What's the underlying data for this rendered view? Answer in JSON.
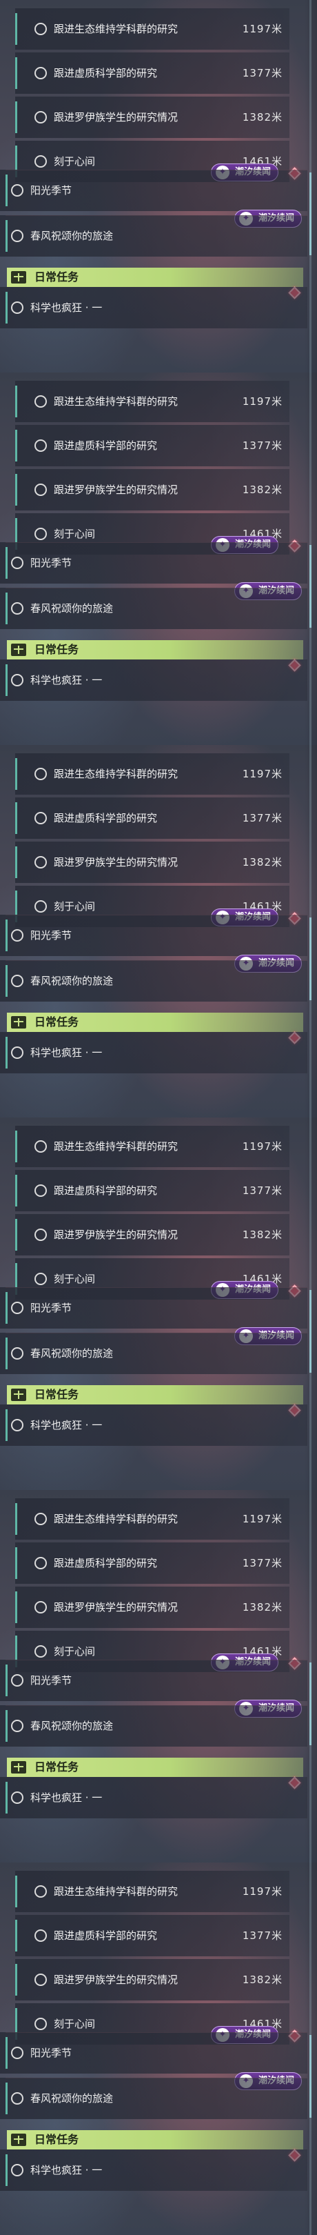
{
  "panels": [
    {
      "quests": [
        {
          "title": "跟进生态维持学科群的研究",
          "distance": "1197米"
        },
        {
          "title": "跟进虚质科学部的研究",
          "distance": "1377米"
        },
        {
          "title": "跟进罗伊族学生的研究情况",
          "distance": "1382米"
        },
        {
          "title": "刻于心间",
          "distance": "1461米"
        }
      ],
      "events": [
        {
          "title": "阳光季节"
        },
        {
          "title": "春风祝颂你的旅途"
        }
      ],
      "badge_label": "潮汐续闻",
      "daily_header": "日常任务",
      "daily_quest": "科学也疯狂 · 一"
    },
    {
      "quests": [
        {
          "title": "跟进生态维持学科群的研究",
          "distance": "1197米"
        },
        {
          "title": "跟进虚质科学部的研究",
          "distance": "1377米"
        },
        {
          "title": "跟进罗伊族学生的研究情况",
          "distance": "1382米"
        },
        {
          "title": "刻于心间",
          "distance": "1461米"
        }
      ],
      "events": [
        {
          "title": "阳光季节"
        },
        {
          "title": "春风祝颂你的旅途"
        }
      ],
      "badge_label": "潮汐续闻",
      "daily_header": "日常任务",
      "daily_quest": "科学也疯狂 · 一"
    },
    {
      "quests": [
        {
          "title": "跟进生态维持学科群的研究",
          "distance": "1197米"
        },
        {
          "title": "跟进虚质科学部的研究",
          "distance": "1377米"
        },
        {
          "title": "跟进罗伊族学生的研究情况",
          "distance": "1382米"
        },
        {
          "title": "刻于心间",
          "distance": "1461米"
        }
      ],
      "events": [
        {
          "title": "阳光季节"
        },
        {
          "title": "春风祝颂你的旅途"
        }
      ],
      "badge_label": "潮汐续闻",
      "daily_header": "日常任务",
      "daily_quest": "科学也疯狂 · 一"
    },
    {
      "quests": [
        {
          "title": "跟进生态维持学科群的研究",
          "distance": "1197米"
        },
        {
          "title": "跟进虚质科学部的研究",
          "distance": "1377米"
        },
        {
          "title": "跟进罗伊族学生的研究情况",
          "distance": "1382米"
        },
        {
          "title": "刻于心间",
          "distance": "1461米"
        }
      ],
      "events": [
        {
          "title": "阳光季节"
        },
        {
          "title": "春风祝颂你的旅途"
        }
      ],
      "badge_label": "潮汐续闻",
      "daily_header": "日常任务",
      "daily_quest": "科学也疯狂 · 一"
    },
    {
      "quests": [
        {
          "title": "跟进生态维持学科群的研究",
          "distance": "1197米"
        },
        {
          "title": "跟进虚质科学部的研究",
          "distance": "1377米"
        },
        {
          "title": "跟进罗伊族学生的研究情况",
          "distance": "1382米"
        },
        {
          "title": "刻于心间",
          "distance": "1461米"
        }
      ],
      "events": [
        {
          "title": "阳光季节"
        },
        {
          "title": "春风祝颂你的旅途"
        }
      ],
      "badge_label": "潮汐续闻",
      "daily_header": "日常任务",
      "daily_quest": "科学也疯狂 · 一"
    },
    {
      "quests": [
        {
          "title": "跟进生态维持学科群的研究",
          "distance": "1197米"
        },
        {
          "title": "跟进虚质科学部的研究",
          "distance": "1377米"
        },
        {
          "title": "跟进罗伊族学生的研究情况",
          "distance": "1382米"
        },
        {
          "title": "刻于心间",
          "distance": "1461米"
        }
      ],
      "events": [
        {
          "title": "阳光季节"
        },
        {
          "title": "春风祝颂你的旅途"
        }
      ],
      "badge_label": "潮汐续闻",
      "daily_header": "日常任务",
      "daily_quest": "科学也疯狂 · 一"
    }
  ],
  "colors": {
    "quest_accent": "#5fb7a6",
    "event_badge": "#6e3a9c",
    "daily_header_bg": "#c9e48a",
    "pin_marker": "#e2566b"
  },
  "icons": {
    "quest_status": "circle-outline-icon",
    "event_badge": "tide-sparkle-icon",
    "daily_header": "book-icon",
    "pin": "diamond-pin-icon"
  }
}
